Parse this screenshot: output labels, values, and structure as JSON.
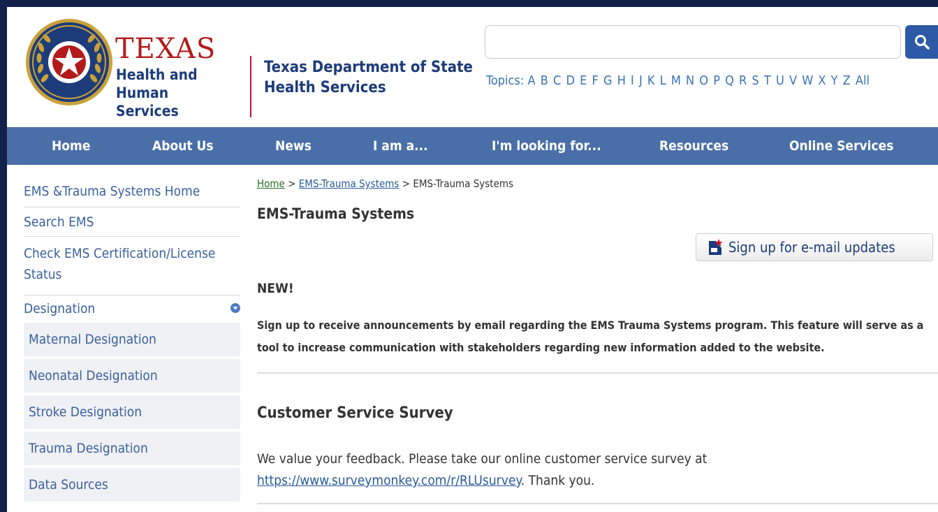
{
  "colors": {
    "nav_bar": "#4a6fa8",
    "brand_red": "#b31b1b",
    "brand_blue": "#1d3c7a",
    "link": "#3a5f9e",
    "search_button": "#2d5aa6",
    "frame": "#13214a"
  },
  "header": {
    "logo": {
      "texas": "TEXAS",
      "line2": "Health and Human",
      "line3": "Services"
    },
    "agency_line1": "Texas Department of State",
    "agency_line2": "Health Services",
    "search": {
      "value": "",
      "button_icon": "search-icon"
    },
    "topics_label": "Topics:",
    "topics": [
      "A",
      "B",
      "C",
      "D",
      "E",
      "F",
      "G",
      "H",
      "I",
      "J",
      "K",
      "L",
      "M",
      "N",
      "O",
      "P",
      "Q",
      "R",
      "S",
      "T",
      "U",
      "V",
      "W",
      "X",
      "Y",
      "Z",
      "All"
    ]
  },
  "nav": [
    "Home",
    "About Us",
    "News",
    "I am a...",
    "I'm looking for...",
    "Resources",
    "Online Services"
  ],
  "sidebar": {
    "items": [
      {
        "label": "EMS &Trauma Systems Home"
      },
      {
        "label": "Search EMS"
      },
      {
        "label": "Check EMS Certification/License Status"
      },
      {
        "label": "Designation",
        "icon": "chevron-down-circle-icon"
      }
    ],
    "sub_items": [
      "Maternal Designation",
      "Neonatal Designation",
      "Stroke Designation",
      "Trauma Designation",
      "Data Sources"
    ]
  },
  "breadcrumb": {
    "home": "Home",
    "sep": ">",
    "section": "EMS-Trauma Systems",
    "current": "EMS-Trauma Systems"
  },
  "page_title": "EMS-Trauma Systems",
  "email_signup": {
    "label": "Sign up for e-mail updates",
    "icon": "email-updates-icon"
  },
  "new_section": {
    "heading": "NEW!",
    "body": "Sign up to receive announcements by email regarding the EMS Trauma Systems program. This feature will serve as a tool to increase communication with stakeholders regarding new information added to the website."
  },
  "survey_section": {
    "heading": "Customer Service Survey",
    "text_before": "We value your feedback. Please take our online customer service survey at ",
    "link": "https://www.surveymonkey.com/r/RLUsurvey",
    "text_after": ". Thank you."
  }
}
